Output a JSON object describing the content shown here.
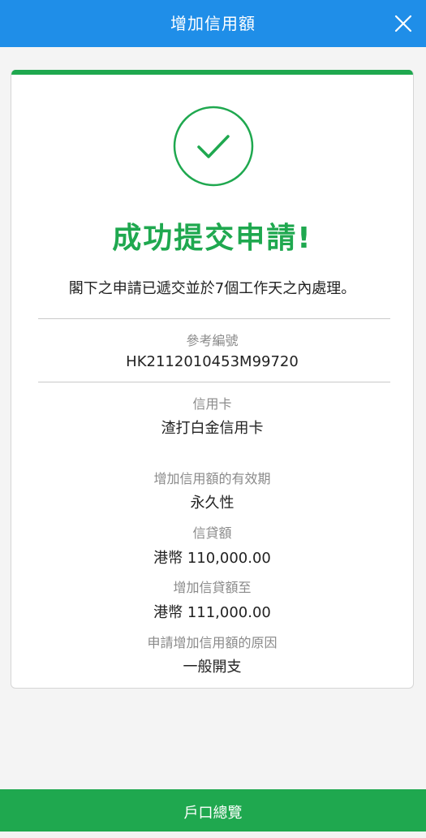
{
  "header": {
    "title": "增加信用額",
    "close_icon": "close-icon"
  },
  "colors": {
    "header_bg": "#1f8ee8",
    "success_green": "#1fa84f",
    "label_gray": "#8a8a8a"
  },
  "result": {
    "icon": "checkmark-circle-icon",
    "title": "成功提交申請!",
    "message": "閣下之申請已遞交並於7個工作天之內處理。"
  },
  "details": {
    "reference": {
      "label": "參考編號",
      "value": "HK2112010453M99720"
    },
    "card": {
      "label": "信用卡",
      "value": "渣打白金信用卡"
    },
    "validity": {
      "label": "增加信用額的有效期",
      "value": "永久性"
    },
    "current_limit": {
      "label": "信貸額",
      "value": "港幣 110,000.00"
    },
    "new_limit": {
      "label": "增加信貸額至",
      "value": "港幣 111,000.00"
    },
    "reason": {
      "label": "申請增加信用額的原因",
      "value": "一般開支"
    }
  },
  "footer": {
    "button_label": "戶口總覽"
  }
}
